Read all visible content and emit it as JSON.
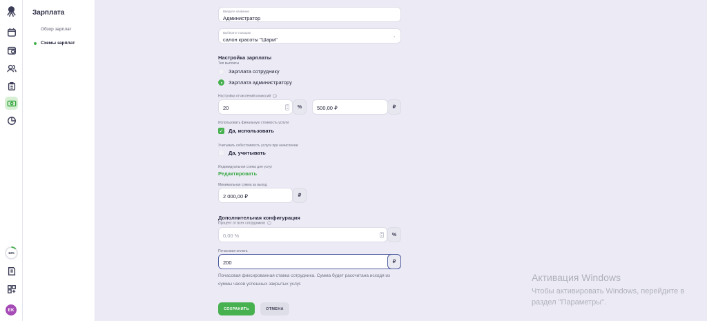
{
  "sidebar_icons": [
    "octopus-logo",
    "calendar-icon",
    "calendar-clock-icon",
    "clients-icon",
    "clipboard-icon",
    "money-icon",
    "chart-pie-icon"
  ],
  "bottom": {
    "progress_label": "13%",
    "progress_value": 0.13,
    "avatar_initials": "EK"
  },
  "subnav": {
    "title": "Зарплата",
    "items": [
      {
        "label": "Обзор зарплат"
      },
      {
        "label": "Схемы зарплат"
      }
    ]
  },
  "form": {
    "name_label": "Введите название",
    "name_value": "Администратор",
    "location_label": "Выберите локацию",
    "location_value": "салон красоты \"Шарм\"",
    "salary_settings_title": "Настройка зарплаты",
    "payment_type_label": "Тип выплаты",
    "payment_options": [
      "Зарплата сотруднику",
      "Зарплата администратору"
    ],
    "commission_label": "Настройка отчислений комиссий",
    "commission_percent": "20",
    "commission_percent_unit": "%",
    "commission_amount": "500,00 ₽",
    "commission_amount_unit": "₽",
    "final_cost_label": "Использовать финальную стоимость услуги",
    "final_cost_option": "Да, использовать",
    "cost_price_label": "Учитывать себестоимость услуги при начислении",
    "cost_price_option": "Да, учитывать",
    "individual_scheme_label": "Индивидуальная схема для услуг",
    "edit_link": "Редактировать",
    "min_amount_label": "Минимальная сумма за выход",
    "min_amount_value": "2 000,00 ₽",
    "min_amount_unit": "₽",
    "additional_title": "Дополнительная конфигурация",
    "percent_all_label": "Процент от всех сотрудников",
    "percent_all_placeholder": "0,00 %",
    "percent_all_unit": "%",
    "hourly_label": "Почасовая оплата",
    "hourly_value": "200",
    "hourly_unit": "₽",
    "hint": "Почасовая фиксированная ставка сотрудника. Сумма будет рассчитана исходя из суммы часов успешных закрытых услуг.",
    "save_button": "СОХРАНИТЬ",
    "cancel_button": "ОТМЕНА"
  },
  "watermark": {
    "title": "Активация Windows",
    "text": "Чтобы активировать Windows, перейдите в раздел \"Параметры\"."
  },
  "colors": {
    "accent": "#47b04f",
    "background": "#ecebf5",
    "avatar": "#a64ab5"
  }
}
